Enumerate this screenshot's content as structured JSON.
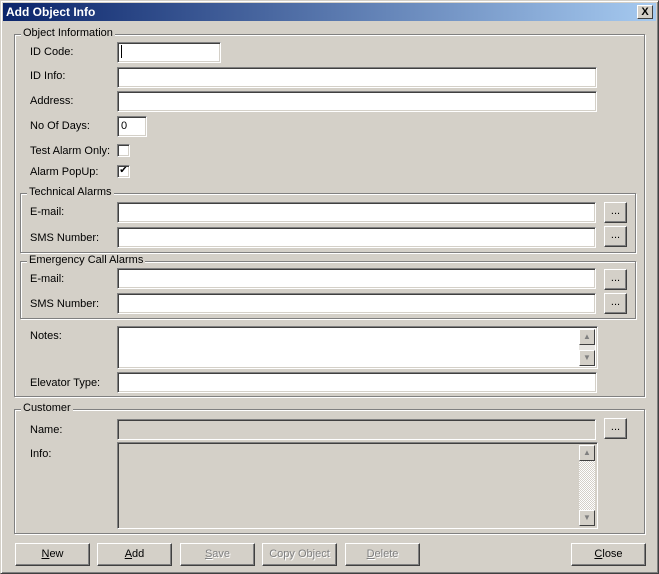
{
  "window": {
    "title": "Add Object Info",
    "close_glyph": "X"
  },
  "object_info": {
    "legend": "Object Information",
    "id_code_label": "ID Code:",
    "id_code_value": "",
    "id_info_label": "ID Info:",
    "id_info_value": "",
    "address_label": "Address:",
    "address_value": "",
    "no_of_days_label": "No Of Days:",
    "no_of_days_value": "0",
    "test_alarm_label": "Test Alarm Only:",
    "test_alarm_checked": false,
    "alarm_popup_label": "Alarm PopUp:",
    "alarm_popup_checked": true,
    "notes_label": "Notes:",
    "notes_value": "",
    "elevator_type_label": "Elevator Type:",
    "elevator_type_value": ""
  },
  "technical_alarms": {
    "legend": "Technical Alarms",
    "email_label": "E-mail:",
    "email_value": "",
    "sms_label": "SMS Number:",
    "sms_value": ""
  },
  "emergency_alarms": {
    "legend": "Emergency Call Alarms",
    "email_label": "E-mail:",
    "email_value": "",
    "sms_label": "SMS Number:",
    "sms_value": ""
  },
  "customer": {
    "legend": "Customer",
    "name_label": "Name:",
    "name_value": "",
    "info_label": "Info:",
    "info_value": ""
  },
  "ellipsis": "...",
  "check_glyph": "✔",
  "scroll": {
    "up_glyph": "▲",
    "down_glyph": "▼"
  },
  "buttons": {
    "new": {
      "mnemonic": "N",
      "rest": "ew"
    },
    "add": {
      "mnemonic": "A",
      "rest": "dd"
    },
    "save": {
      "mnemonic": "S",
      "rest": "ave"
    },
    "copy_object": "Copy Object",
    "delete": {
      "mnemonic": "D",
      "rest": "elete"
    },
    "close": {
      "mnemonic": "C",
      "rest": "lose"
    }
  }
}
